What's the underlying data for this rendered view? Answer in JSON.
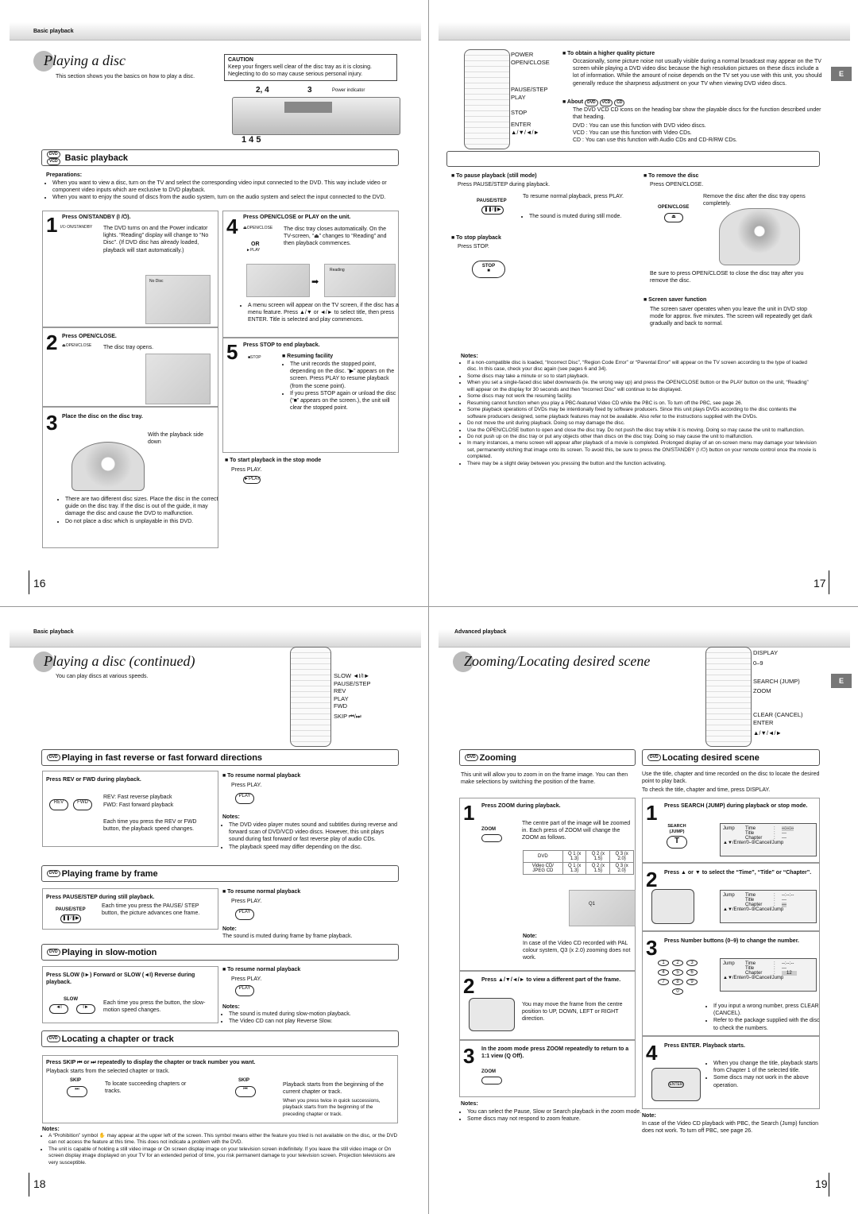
{
  "p16": {
    "header": "Basic playback",
    "title": "Playing a disc",
    "subtitle": "This section shows you the basics on how to play a disc.",
    "caution_title": "CAUTION",
    "caution_text": "Keep your fingers well clear of the disc tray as it is closing. Neglecting to do so may cause serious personal injury.",
    "player_label_a": "2, 4",
    "player_label_b": "3",
    "player_power": "Power indicator",
    "player_label_c": "1 4 5",
    "section": "Basic playback",
    "badges": [
      "DVD",
      "VCD",
      "CD"
    ],
    "prep_title": "Preparations:",
    "prep": [
      "When you want to view a disc, turn on the TV and select the corresponding video input connected to the DVD. This way include video or component video inputs which are exclusive to DVD playback.",
      "When you want to enjoy the sound of discs from the audio system, turn on the audio system and select the input connected to the DVD."
    ],
    "s1_num": "1",
    "s1_title": "Press ON/STANDBY (I /⏻).",
    "s1_btn": "I/⏻ ON/STANDBY",
    "s1_text": "The DVD turns on and the Power indicator lights. “Reading” display will change to “No Disc”. (If DVD disc has already loaded, playback will start automatically.)",
    "s1_screen": "No Disc",
    "s2_num": "2",
    "s2_title": "Press OPEN/CLOSE.",
    "s2_btn": "⏏OPEN/CLOSE",
    "s2_text": "The disc tray opens.",
    "s3_num": "3",
    "s3_title": "Place the disc on the disc tray.",
    "s3_text": "With the playback side down",
    "s3_bullets": [
      "There are two different disc sizes. Place the disc in the correct guide on the disc tray. If the disc is out of the guide, it may damage the disc and cause the DVD to malfunction.",
      "Do not place a disc which is unplayable in this DVD."
    ],
    "s4_num": "4",
    "s4_title": "Press OPEN/CLOSE or PLAY on the unit.",
    "s4_btn1": "⏏OPEN/CLOSE",
    "s4_or": "OR",
    "s4_btn2": "►PLAY",
    "s4_text": "The disc tray closes automatically. On the TV-screen, “⏏” changes to “Reading” and then playback commences.",
    "s4_screen": "Reading",
    "s4_bullet": "A menu screen will appear on the TV screen, if the disc has a menu feature. Press ▲/▼ or ◄/► to select title, then press ENTER. Title is selected and play commences.",
    "s5_num": "5",
    "s5_title": "Press STOP to end playback.",
    "s5_btn": "■STOP",
    "s5_sub": "■ Resuming facility",
    "s5_bullets": [
      "The unit records the stopped point, depending on the disc. “▶” appears on the screen. Press PLAY to resume playback (from the scene point).",
      "If you press STOP again or unload the disc (“■” appears on the screen.), the unit will clear the stopped point."
    ],
    "stop_mode_title": "■ To start playback in the stop mode",
    "stop_mode_text": "Press PLAY.",
    "play_btn": "►PLAY",
    "page": "16"
  },
  "p17": {
    "remote_labels": [
      "POWER",
      "OPEN/CLOSE",
      "PAUSE/STEP",
      "PLAY",
      "STOP",
      "ENTER",
      "▲/▼/◄/►"
    ],
    "quality_title": "■ To obtain a higher quality picture",
    "quality_text": "Occasionally, some picture noise not usually visible during a normal broadcast may appear on the TV screen while playing a DVD video disc because the high resolution pictures on these discs include a lot of information. While the amount of noise depends on the TV set you use with this unit, you should generally reduce the sharpness adjustment on your TV when viewing DVD video discs.",
    "about_title": "■ About",
    "about_text": "The DVD VCD CD icons on the heading bar show the playable discs for the function described under that heading.",
    "about_items": [
      "DVD : You can use this function with DVD video discs.",
      "VCD : You can use this function with Video CDs.",
      "CD : You can use this function with Audio CDs and CD-R/RW CDs."
    ],
    "etab": "E",
    "pause_title": "■ To pause playback (still mode)",
    "pause_text": "Press PAUSE/STEP during playback.",
    "pause_btn": "PAUSE/STEP",
    "pause_resume": "To resume normal playback, press PLAY.",
    "pause_bullet": "The sound is muted during still mode.",
    "stop_title": "■ To stop playback",
    "stop_text": "Press STOP.",
    "stop_btn": "STOP",
    "remove_title": "■ To remove the disc",
    "remove_text": "Press OPEN/CLOSE.",
    "remove_btn": "OPEN/CLOSE",
    "remove_desc": "Remove the disc after the disc tray opens completely.",
    "remove_note": "Be sure to press OPEN/CLOSE to close the disc tray after you remove the disc.",
    "saver_title": "■ Screen saver function",
    "saver_text": "The screen saver operates when you leave the unit in DVD stop mode for approx. five minutes. The screen will repeatedly get dark gradually and back to normal.",
    "notes_title": "Notes:",
    "notes": [
      "If a non-compatible disc is loaded, “Incorrect Disc”, “Region Code Error” or “Parental Error” will appear on the TV screen according to the type of loaded disc. In this case, check your disc again (see pages 6 and 34).",
      "Some discs may take a minute or so to start playback.",
      "When you set a single-faced disc label downwards (ie. the wrong way up) and press the OPEN/CLOSE button or the PLAY button on the unit, “Reading” will appear on the display for 30 seconds and then “Incorrect Disc” will continue to be displayed.",
      "Some discs may not work the resuming facility.",
      "Resuming cannot function when you play a PBC-featured Video CD while the PBC is on. To turn off the PBC, see page 26.",
      "Some playback operations of DVDs may be intentionally fixed by software producers. Since this unit plays DVDs according to the disc contents the software producers designed, some playback features may not be available. Also refer to the instructions supplied with the DVDs.",
      "Do not move the unit during playback. Doing so may damage the disc.",
      "Use the OPEN/CLOSE button to open and close the disc tray. Do not push the disc tray while it is moving. Doing so may cause the unit to malfunction.",
      "Do not push up on the disc tray or put any objects other than discs on the disc tray. Doing so may cause the unit to malfunction.",
      "In many instances, a menu screen will appear after playback of a movie is completed. Prolonged display of an on-screen menu may damage your television set, permanently etching that image onto its screen. To avoid this, be sure to press the ON/STANDBY (I /⏻) button on your remote control once the movie is completed.",
      "There may be a slight delay between you pressing the button and the function activating."
    ],
    "page": "17"
  },
  "p18": {
    "header": "Basic playback",
    "title": "Playing a disc (continued)",
    "subtitle": "You can play discs at various speeds.",
    "remote_labels": [
      "SLOW ◄I/I►",
      "PAUSE/STEP",
      "REV",
      "PLAY",
      "FWD",
      "SKIP ⏮/⏭"
    ],
    "sec1": "Playing in fast reverse or fast forward directions",
    "s1_title": "Press REV or FWD during playback.",
    "s1_rev": "REV",
    "s1_fwd": "FWD",
    "s1_l1": "REV: Fast reverse playback",
    "s1_l2": "FWD: Fast forward playback",
    "s1_text": "Each time you press the REV or FWD button, the playback speed changes.",
    "resume_title": "■ To resume normal playback",
    "resume_text": "Press PLAY.",
    "play_btn": "PLAY",
    "s1_notes_title": "Notes:",
    "s1_notes": [
      "The DVD video player mutes sound and subtitles during reverse and forward scan of DVD/VCD video discs. However, this unit plays sound during fast forward or fast reverse play of audio CDs.",
      "The playback speed may differ depending on the disc."
    ],
    "sec2": "Playing frame by frame",
    "s2_title": "Press PAUSE/STEP during still playback.",
    "s2_btn": "PAUSE/STEP",
    "s2_text": "Each time you press the PAUSE/ STEP button, the picture advances one frame.",
    "s2_note_title": "Note:",
    "s2_note": "The sound is muted during frame by frame playback.",
    "sec3": "Playing in slow-motion",
    "s3_title": "Press SLOW (I►) Forward or SLOW (◄I) Reverse during playback.",
    "s3_btn": "SLOW",
    "s3_text": "Each time you press the button, the slow-motion speed changes.",
    "s3_notes_title": "Notes:",
    "s3_notes": [
      "The sound is muted during slow-motion playback.",
      "The Video CD can not play Reverse Slow."
    ],
    "sec4": "Locating a chapter or track",
    "s4_title": "Press SKIP ⏮ or ⏭ repeatedly to display the chapter or track number you want.",
    "s4_sub": "Playback starts from the selected chapter or track.",
    "s4_btn": "SKIP",
    "s4_next": "To locate succeeding chapters or tracks.",
    "s4_prev": "Playback starts from the beginning of the current chapter or track.",
    "s4_prev2": "When you press twice in quick successions, playback starts from the beginning of the preceding chapter or track.",
    "notes_title": "Notes:",
    "notes": [
      "A “Prohibition” symbol ✋ may appear at the upper left of the screen. This symbol means either the feature you tried is not available on the disc, or the DVD can not access the feature at this time. This does not indicate a problem with the DVD.",
      "The unit is capable of holding a still video image or On screen display image on your television screen indefinitely. If you leave the still video image or On screen display image displayed on your TV for an extended period of time, you risk permanent damage to your television screen. Projection televisions are very susceptible."
    ],
    "page": "18"
  },
  "p19": {
    "header": "Advanced playback",
    "title": "Zooming/Locating desired scene",
    "remote_labels": [
      "DISPLAY",
      "0–9",
      "SEARCH (JUMP)",
      "ZOOM",
      "CLEAR (CANCEL)",
      "ENTER",
      "▲/▼/◄/►"
    ],
    "etab": "E",
    "zsec": "Zooming",
    "zintro": "This unit will allow you to zoom in on the frame image. You can then make selections by switching the position of the frame.",
    "z1_num": "1",
    "z1_title": "Press ZOOM during playback.",
    "z_btn": "ZOOM",
    "z1_text": "The centre part of the image will be zoomed in. Each press of ZOOM will change the ZOOM as follows.",
    "ztable": [
      [
        "DVD",
        "Q 1 (x 1.3)",
        "Q 2 (x 1.5)",
        "Q 3 (x 2.0)"
      ],
      [
        "Video CD/ JPEG CD",
        "Q 1 (x 1.3)",
        "Q 2 (x 1.5)",
        "Q 3 (x 2.0)"
      ]
    ],
    "z1_screen": "Q1",
    "z1_note_title": "Note:",
    "z1_note": "In case of the Video CD recorded with PAL colour system, Q3 (x 2.0) zooming does not work.",
    "z2_num": "2",
    "z2_title": "Press ▲/▼/◄/► to view a different part of the frame.",
    "z2_text": "You may move the frame from the centre position to UP, DOWN, LEFT or RIGHT direction.",
    "z3_num": "3",
    "z3_title": "In the zoom mode press ZOOM repeatedly to return to a 1:1 view (Q Off).",
    "znotes_title": "Notes:",
    "znotes": [
      "You can select the Pause, Slow or Search playback in the zoom mode.",
      "Some discs may not respond to zoom feature."
    ],
    "lsec": "Locating desired scene",
    "lintro": "Use the title, chapter and time recorded on the disc to locate the desired point to play back.",
    "lintro2": "To check the title, chapter and time, press DISPLAY.",
    "l1_num": "1",
    "l1_title": "Press SEARCH (JUMP) during playback or stop mode.",
    "l1_btn": "SEARCH (JUMP)",
    "l1_btn_glyph": "T",
    "jump": {
      "label": "Jump",
      "rows": [
        [
          "Time",
          ":",
          "--:--:--"
        ],
        [
          "Title",
          ":",
          "---"
        ],
        [
          "Chapter",
          ":",
          "---"
        ]
      ],
      "help": "▲▼/Enter/0–9/Cancel/Jump"
    },
    "l2_num": "2",
    "l2_title": "Press ▲ or ▼ to select the “Time”, “Title” or “Chapter”.",
    "l3_num": "3",
    "l3_title": "Press Number buttons (0–9) to change the number.",
    "l3_chapter": "12",
    "l3_bullets": [
      "If you input a wrong number, press CLEAR (CANCEL).",
      "Refer to the package supplied with the disc to check the numbers."
    ],
    "numpad": [
      "1",
      "2",
      "3",
      "4",
      "5",
      "6",
      "7",
      "8",
      "9",
      "0"
    ],
    "l4_num": "4",
    "l4_title": "Press ENTER. Playback starts.",
    "enter": "ENTER",
    "l4_bullets": [
      "When you change the title, playback starts from Chapter 1 of the selected title.",
      "Some discs may not work in the above operation."
    ],
    "lnote_title": "Note:",
    "lnote": "In case of the Video CD playback with PBC, the Search (Jump) function does not work. To turn off PBC, see page 26.",
    "page": "19"
  }
}
